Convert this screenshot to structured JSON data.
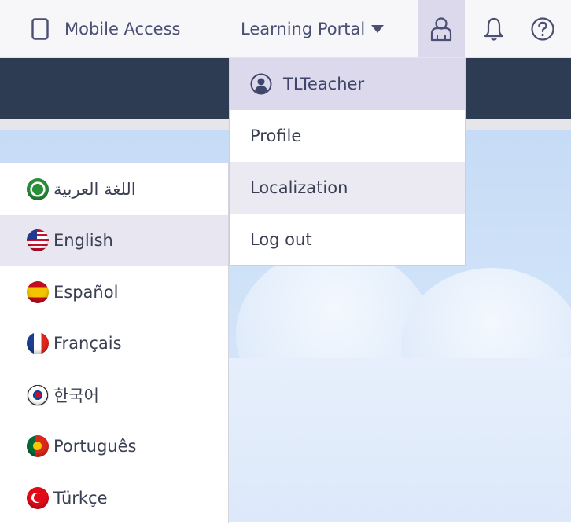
{
  "topbar": {
    "mobile_access_label": "Mobile Access",
    "learning_portal_label": "Learning Portal"
  },
  "user_menu": {
    "username": "TLTeacher",
    "items": [
      {
        "label": "Profile"
      },
      {
        "label": "Localization"
      },
      {
        "label": "Log out"
      }
    ]
  },
  "languages": [
    {
      "label": "اللغة العربية",
      "flag": "arabic-flag-icon"
    },
    {
      "label": "English",
      "flag": "us-flag-icon",
      "selected": true
    },
    {
      "label": "Español",
      "flag": "spain-flag-icon"
    },
    {
      "label": "Français",
      "flag": "france-flag-icon"
    },
    {
      "label": "한국어",
      "flag": "korea-flag-icon"
    },
    {
      "label": "Português",
      "flag": "portugal-flag-icon"
    },
    {
      "label": "Türkçe",
      "flag": "turkey-flag-icon"
    }
  ],
  "colors": {
    "topbar_bg": "#f7f7f9",
    "nav_band": "#2d3c52",
    "active_item": "#dcd9ec",
    "text_accent": "#4a4f73"
  }
}
